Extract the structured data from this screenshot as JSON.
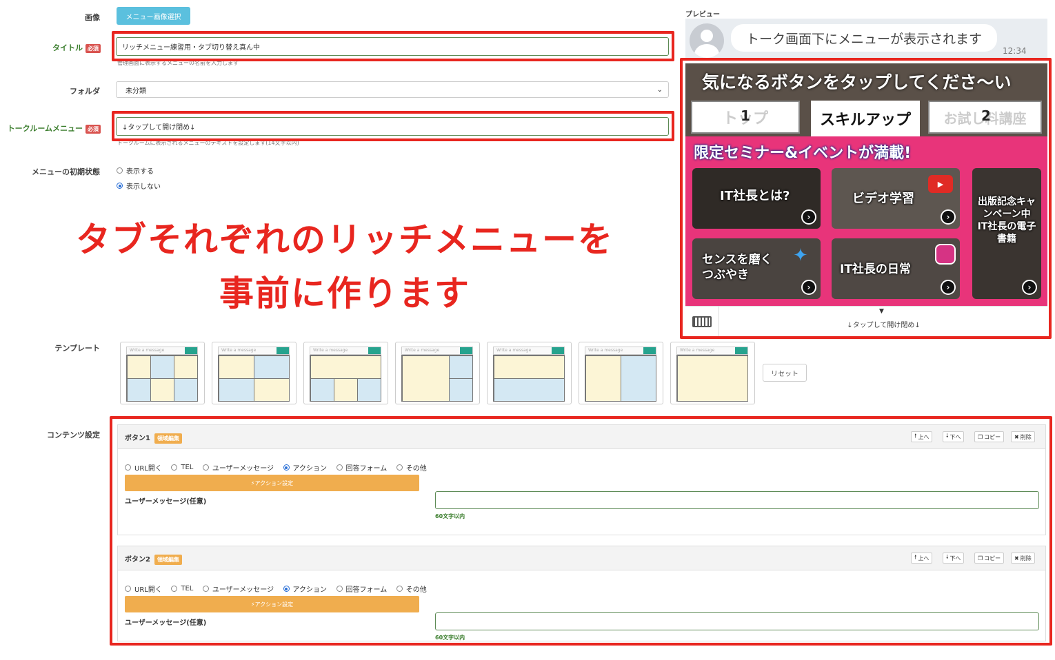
{
  "form": {
    "image_label": "画像",
    "image_button": "メニュー画像選択",
    "title_label": "タイトル",
    "required": "必須",
    "title_value": "リッチメニュー練習用・タブ切り替え真ん中",
    "title_help": "管理画面に表示するメニューの名前を入力します",
    "folder_label": "フォルダ",
    "folder_value": "未分類",
    "talk_menu_label": "トークルームメニュー",
    "talk_menu_value": "↓タップして開け閉め↓",
    "talk_menu_help": "トークルームに表示されるメニューのテキストを設定します(14文字以内)",
    "initial_state_label": "メニューの初期状態",
    "initial_state_options": [
      "表示する",
      "表示しない"
    ],
    "template_label": "テンプレート",
    "template_placeholder": "Write a message",
    "reset_button": "リセット",
    "content_label": "コンテンツ設定"
  },
  "annotation": {
    "line1": "タブそれぞれのリッチメニューを",
    "line2": "事前に作ります"
  },
  "preview": {
    "label": "プレビュー",
    "bubble": "トーク画面下にメニューが表示されます",
    "time": "12:34",
    "menu_heading": "気になるボタンをタップしてくださ～い",
    "tabs": [
      "トップ",
      "スキルアップ",
      "お試し料講座"
    ],
    "tab_badges": [
      "1",
      "2"
    ],
    "banner": "限定セミナー&イベントが満載!",
    "tiles": [
      "IT社長とは?",
      "ビデオ学習",
      "出版記念キャンペーン中 IT社長の電子書籍",
      "センスを磨くつぶやき",
      "IT社長の日常"
    ],
    "footer": "↓タップして開け閉め↓"
  },
  "buttons": [
    {
      "title": "ボタン1",
      "tag": "領域編集",
      "up": "上へ",
      "down": "下へ",
      "copy": "コピー",
      "delete": "削除",
      "options": [
        "URL開く",
        "TEL",
        "ユーザーメッセージ",
        "アクション",
        "回答フォーム",
        "その他"
      ],
      "selected": 3,
      "action": "アクション設定",
      "msg_label": "ユーザーメッセージ(任意)",
      "msg_help": "60文字以内"
    },
    {
      "title": "ボタン2",
      "tag": "領域編集",
      "up": "上へ",
      "down": "下へ",
      "copy": "コピー",
      "delete": "削除",
      "options": [
        "URL開く",
        "TEL",
        "ユーザーメッセージ",
        "アクション",
        "回答フォーム",
        "その他"
      ],
      "selected": 3,
      "action": "アクション設定",
      "msg_label": "ユーザーメッセージ(任意)",
      "msg_help": "60文字以内"
    }
  ],
  "colors": {
    "highlight": "#e8261f",
    "accent": "#f0ad4e",
    "teal": "#26a38e",
    "banner_pink": "#e8347a"
  }
}
